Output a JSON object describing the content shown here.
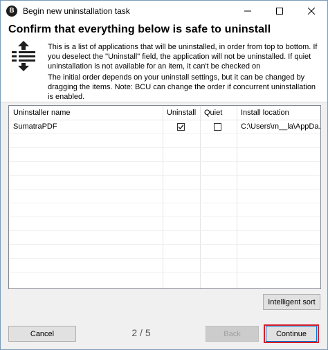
{
  "window": {
    "title": "Begin new uninstallation task",
    "app_icon_letter": "B"
  },
  "header": {
    "heading": "Confirm that everything below is safe to uninstall",
    "description1": "This is a list of applications that will be uninstalled, in order from top to bottom. If you deselect the \"Uninstall\" field, the application will not be uninstalled. If quiet uninstallation is not available for an item, it can't be checked on",
    "description2": "The initial order depends on your uninstall settings, but it can be changed by dragging the items. Note: BCU can change the order if concurrent uninstallation is enabled."
  },
  "list": {
    "columns": [
      "Uninstaller name",
      "Uninstall",
      "Quiet",
      "Install location"
    ],
    "rows": [
      {
        "name": "SumatraPDF",
        "uninstall": true,
        "quiet": false,
        "location": "C:\\Users\\m__la\\AppDa..."
      }
    ]
  },
  "buttons": {
    "intelligent_sort": "Intelligent sort",
    "cancel": "Cancel",
    "back": "Back",
    "continue": "Continue"
  },
  "page_indicator": "2 / 5",
  "colors": {
    "highlight": "#d81f2a",
    "primary_border": "#0078d7"
  }
}
